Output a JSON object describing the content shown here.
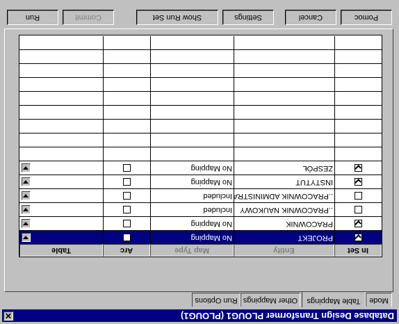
{
  "window": {
    "title": "Database Design Transformer PLOUG1 (PLOUG1)",
    "close_label": "✕"
  },
  "tabs": [
    {
      "label": "Mode"
    },
    {
      "label": "Table Mappings"
    },
    {
      "label": "Other Mappings"
    },
    {
      "label": "Run Options"
    }
  ],
  "grid": {
    "headers": {
      "in_set": "In Set",
      "entity": "Entity",
      "map_type": "Map Type",
      "arc": "Arc",
      "table": "Table"
    },
    "rows": [
      {
        "entity": "PROJEKT",
        "map_type": "No Mapping",
        "in_set": true,
        "arc": false,
        "selected": true
      },
      {
        "entity": "PRACOWNIK",
        "map_type": "No Mapping",
        "in_set": true,
        "arc": false,
        "selected": false
      },
      {
        "entity": "..PRACOWNIK NAUKOWY",
        "map_type": "Included",
        "in_set": false,
        "arc": false,
        "selected": false
      },
      {
        "entity": "..PRACOWNIK ADMINISTRA",
        "map_type": "Included",
        "in_set": false,
        "arc": false,
        "selected": false
      },
      {
        "entity": "INSTYTUT",
        "map_type": "No Mapping",
        "in_set": true,
        "arc": false,
        "selected": false
      },
      {
        "entity": "ZESPÓŁ",
        "map_type": "No Mapping",
        "in_set": true,
        "arc": false,
        "selected": false
      }
    ]
  },
  "buttons": {
    "run": "Run",
    "commit": "Commit",
    "show_run_set": "Show Run Set",
    "settings": "Settings",
    "cancel": "Cancel",
    "help": "Pomoc"
  }
}
